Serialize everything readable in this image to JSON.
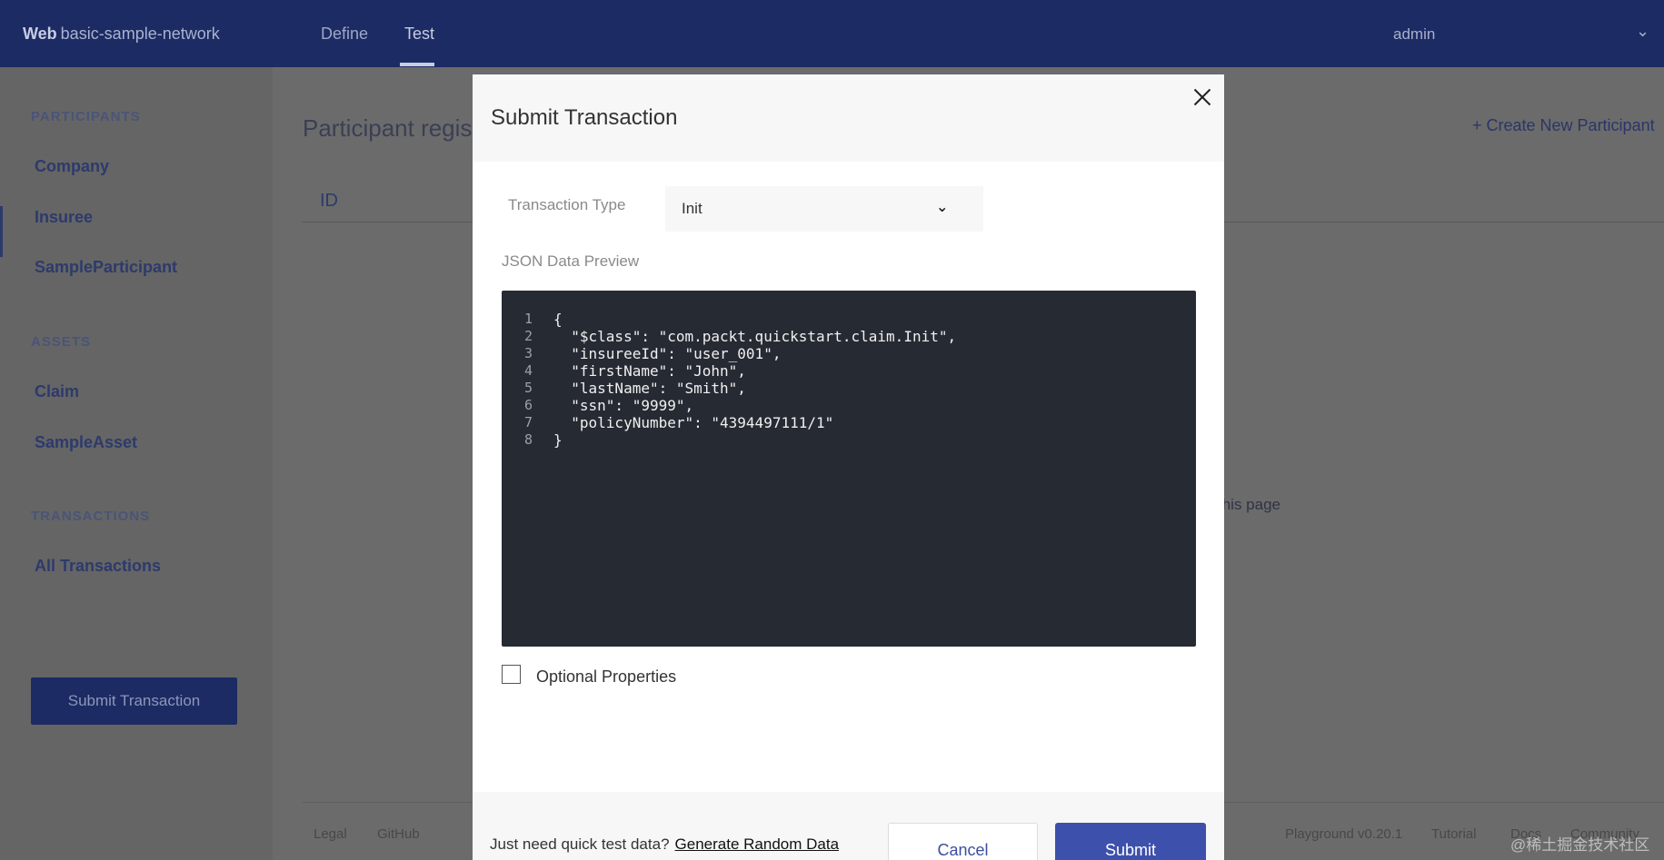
{
  "header": {
    "brand_bold": "Web",
    "brand_name": "basic-sample-network",
    "tabs": [
      {
        "label": "Define"
      },
      {
        "label": "Test"
      }
    ],
    "user": "admin"
  },
  "sidebar": {
    "participants_heading": "PARTICIPANTS",
    "participants": [
      "Company",
      "Insuree",
      "SampleParticipant"
    ],
    "assets_heading": "ASSETS",
    "assets": [
      "Claim",
      "SampleAsset"
    ],
    "transactions_heading": "TRANSACTIONS",
    "transactions": [
      "All Transactions"
    ],
    "submit_label": "Submit Transaction"
  },
  "main": {
    "title": "Participant registr",
    "create_label": "+ Create New Participant",
    "column_id": "ID",
    "partial_text": "this page"
  },
  "footer": {
    "links": [
      "Legal",
      "GitHub",
      "Playground v0.20.1",
      "Tutorial",
      "Docs",
      "Community"
    ]
  },
  "modal": {
    "title": "Submit Transaction",
    "transaction_type_label": "Transaction Type",
    "transaction_type_value": "Init",
    "json_label": "JSON Data Preview",
    "code_lines": [
      {
        "n": "1",
        "text": "{"
      },
      {
        "n": "2",
        "text": "  \"$class\": \"com.packt.quickstart.claim.Init\","
      },
      {
        "n": "3",
        "text": "  \"insureeId\": \"user_001\","
      },
      {
        "n": "4",
        "text": "  \"firstName\": \"John\","
      },
      {
        "n": "5",
        "text": "  \"lastName\": \"Smith\","
      },
      {
        "n": "6",
        "text": "  \"ssn\": \"9999\","
      },
      {
        "n": "7",
        "text": "  \"policyNumber\": \"4394497111/1\""
      },
      {
        "n": "8",
        "text": "}"
      }
    ],
    "optional_label": "Optional Properties",
    "quick_text": "Just need quick test data?",
    "generate_label": "Generate Random Data",
    "cancel_label": "Cancel",
    "submit_label": "Submit"
  },
  "watermark": "@稀土掘金技术社区"
}
